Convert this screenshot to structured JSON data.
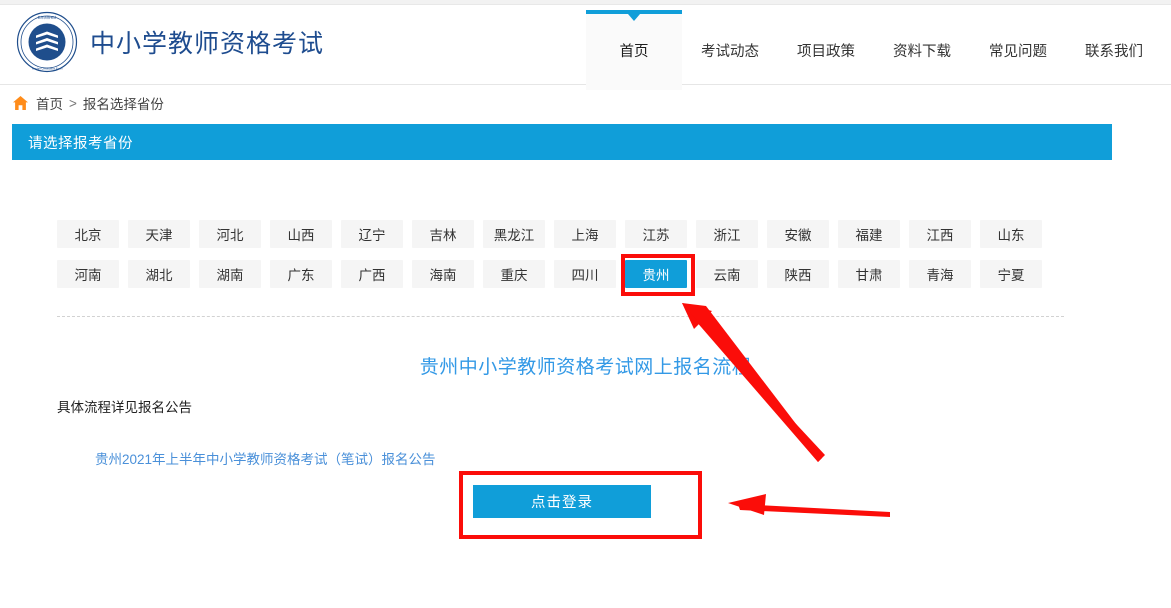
{
  "site": {
    "brand_title": "中小学教师资格考试",
    "logo_name": "exam-seal-logo"
  },
  "nav": {
    "items": [
      {
        "label": "首页",
        "active": true
      },
      {
        "label": "考试动态",
        "active": false
      },
      {
        "label": "项目政策",
        "active": false
      },
      {
        "label": "资料下载",
        "active": false
      },
      {
        "label": "常见问题",
        "active": false
      },
      {
        "label": "联系我们",
        "active": false
      }
    ]
  },
  "breadcrumb": {
    "home_icon": "home-icon",
    "home_label": "首页",
    "separator": ">",
    "current": "报名选择省份"
  },
  "banner": {
    "title": "请选择报考省份"
  },
  "provinces": {
    "selected": "贵州",
    "rows": [
      [
        "北京",
        "天津",
        "河北",
        "山西",
        "辽宁",
        "吉林",
        "黑龙江",
        "上海",
        "江苏",
        "浙江",
        "安徽",
        "福建",
        "江西",
        "山东"
      ],
      [
        "河南",
        "湖北",
        "湖南",
        "广东",
        "广西",
        "海南",
        "重庆",
        "四川",
        "贵州",
        "云南",
        "陕西",
        "甘肃",
        "青海",
        "宁夏"
      ]
    ]
  },
  "flow": {
    "title": "贵州中小学教师资格考试网上报名流程",
    "note": "具体流程详见报名公告",
    "link": "贵州2021年上半年中小学教师资格考试（笔试）报名公告",
    "login_button": "点击登录"
  },
  "colors": {
    "accent_blue": "#109ed9",
    "brand_navy": "#1e4c8f",
    "link_blue": "#4a90d9",
    "annotation_red": "#fb0d09",
    "home_orange": "#ff8c1a",
    "button_gray": "#f5f5f5"
  },
  "annotations": {
    "province_box": "贵州",
    "login_box": "点击登录",
    "arrow_to_province": "diagonal-arrow-up-left",
    "arrow_to_login": "horizontal-arrow-left"
  }
}
